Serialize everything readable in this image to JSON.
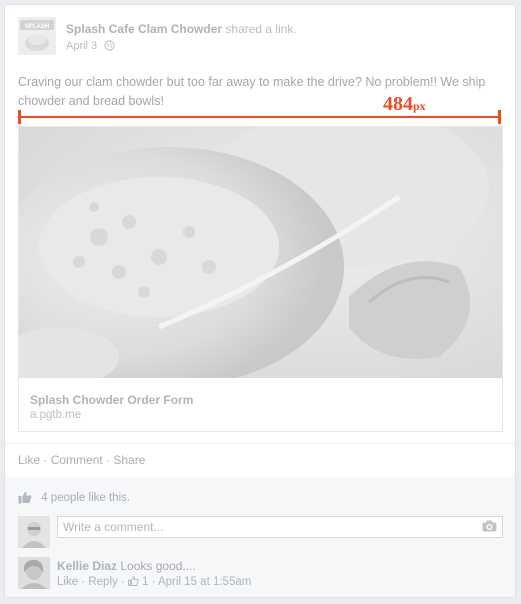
{
  "post": {
    "page_name": "Splash Cafe Clam Chowder",
    "action": "shared a link.",
    "date": "April 3",
    "message": "Craving our clam chowder but too far away to make the drive? No problem!! We ship chowder and bread bowls!",
    "avatar_text": "SPLASH"
  },
  "annotation": {
    "value": "484",
    "unit": "px",
    "color": "#f04a1e"
  },
  "link_preview": {
    "title": "Splash Chowder Order Form",
    "domain": "a.pgtb.me"
  },
  "actions": {
    "like": "Like",
    "sep1": " · ",
    "comment": "Comment",
    "sep2": " · ",
    "share": "Share"
  },
  "likes": {
    "text": "4 people like this."
  },
  "comment_input": {
    "placeholder": "Write a comment..."
  },
  "comments": [
    {
      "author": "Kellie Diaz",
      "text": "Looks good....",
      "like": "Like",
      "sep1": " · ",
      "reply": "Reply",
      "sep2": " · ",
      "like_count": "1",
      "sep3": " · ",
      "timestamp": "April 15 at 1:55am"
    }
  ]
}
